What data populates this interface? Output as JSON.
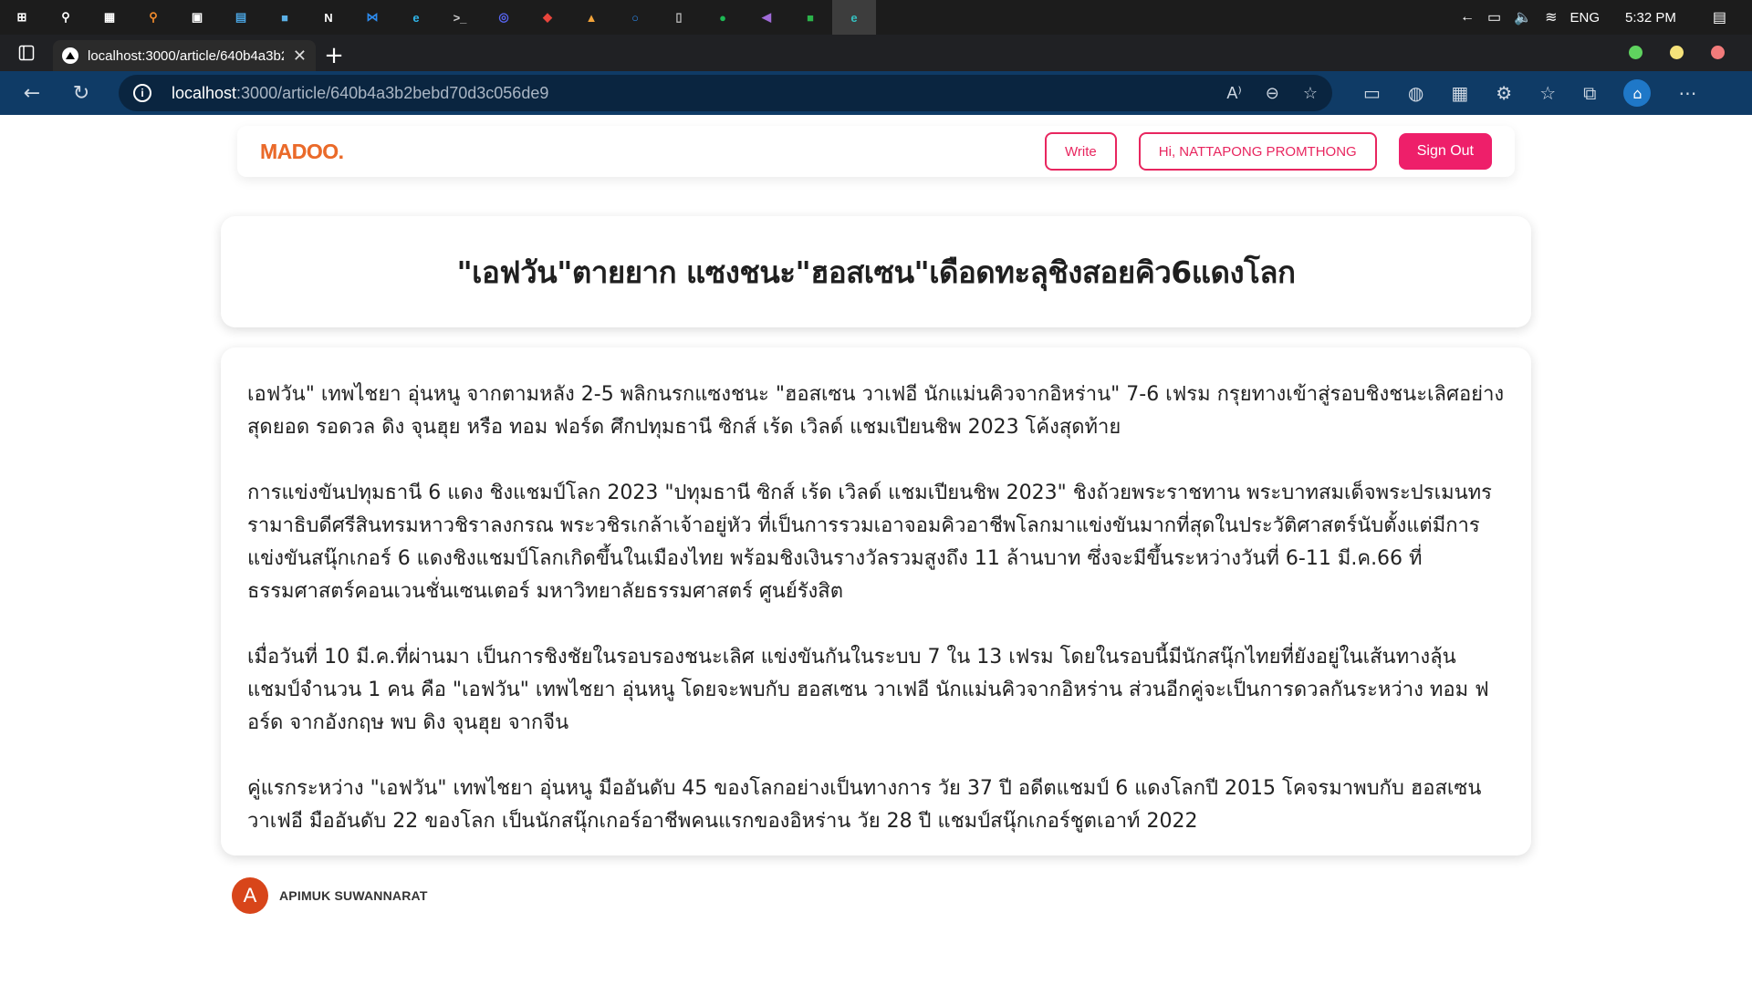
{
  "taskbar": {
    "apps": [
      {
        "name": "start-icon",
        "glyph": "⊞",
        "color": "#ffffff"
      },
      {
        "name": "search-icon",
        "glyph": "⚲",
        "color": "#ffffff"
      },
      {
        "name": "task-view-icon",
        "glyph": "▦",
        "color": "#ffffff"
      },
      {
        "name": "search-app-icon",
        "glyph": "⚲",
        "color": "#f08a2c"
      },
      {
        "name": "app-icon",
        "glyph": "▣",
        "color": "#ffffff"
      },
      {
        "name": "calculator-icon",
        "glyph": "▤",
        "color": "#4aa3df"
      },
      {
        "name": "folder-icon",
        "glyph": "■",
        "color": "#5bb0e6"
      },
      {
        "name": "notion-icon",
        "glyph": "N",
        "color": "#ffffff"
      },
      {
        "name": "vscode-icon",
        "glyph": "⋈",
        "color": "#2d8cf0"
      },
      {
        "name": "edge-icon",
        "glyph": "e",
        "color": "#2fb5e8"
      },
      {
        "name": "terminal-icon",
        "glyph": ">_",
        "color": "#cccccc"
      },
      {
        "name": "discord-icon",
        "glyph": "◎",
        "color": "#5865f2"
      },
      {
        "name": "app-red-icon",
        "glyph": "◆",
        "color": "#e8453c"
      },
      {
        "name": "app-orange-icon",
        "glyph": "▲",
        "color": "#f2a33a"
      },
      {
        "name": "circle-app-icon",
        "glyph": "○",
        "color": "#2d8cf0"
      },
      {
        "name": "app-dark-icon",
        "glyph": "▯",
        "color": "#bbbbbb"
      },
      {
        "name": "spotify-icon",
        "glyph": "●",
        "color": "#1db954"
      },
      {
        "name": "visual-studio-icon",
        "glyph": "◀",
        "color": "#a06bd8"
      },
      {
        "name": "line-icon",
        "glyph": "■",
        "color": "#2bb34a"
      },
      {
        "name": "edge-active-icon",
        "glyph": "e",
        "color": "#35c0c0"
      }
    ],
    "tray": {
      "lang": "ENG",
      "time": "5:32 PM"
    }
  },
  "browser": {
    "tab_title": "localhost:3000/article/640b4a3b2",
    "url_host": "localhost",
    "url_path": ":3000/article/640b4a3b2bebd70d3c056de9"
  },
  "site": {
    "logo": "MADOO.",
    "write_label": "Write",
    "greeting": "Hi, NATTAPONG PROMTHONG",
    "signout_label": "Sign Out"
  },
  "article": {
    "title": "\"เอฟวัน\"ตายยาก แซงชนะ\"ฮอสเซน\"เดือดทะลุชิงสอยคิว6แดงโลก",
    "paragraphs": [
      "เอฟวัน\" เทพไชยา อุ่นหนู จากตามหลัง 2-5 พลิกนรกแซงชนะ \"ฮอสเซน วาเฟอี นักแม่นคิวจากอิหร่าน\" 7-6 เฟรม กรุยทางเข้าสู่รอบชิงชนะเลิศอย่างสุดยอด รอดวล ดิง จุนฮุย หรือ ทอม ฟอร์ด ศึกปทุมธานี ซิกส์ เร้ด เวิลด์ แชมเปียนชิพ 2023 โค้งสุดท้าย",
      "การแข่งขันปทุมธานี 6 แดง ชิงแชมป์โลก 2023 \"ปทุมธานี ซิกส์ เร้ด เวิลด์ แชมเปียนชิพ 2023\" ชิงถ้วยพระราชทาน พระบาทสมเด็จพระปรเมนทรรามาธิบดีศรีสินทรมหาวชิราลงกรณ พระวชิรเกล้าเจ้าอยู่หัว ที่เป็นการรวมเอาจอมคิวอาชีพโลกมาแข่งขันมากที่สุดในประวัติศาสตร์นับตั้งแต่มีการแข่งขันสนุ๊กเกอร์ 6 แดงชิงแชมป์โลกเกิดขึ้นในเมืองไทย พร้อมชิงเงินรางวัลรวมสูงถึง 11 ล้านบาท ซึ่งจะมีขึ้นระหว่างวันที่ 6-11 มี.ค.66 ที่ธรรมศาสตร์คอนเวนชั่นเซนเตอร์ มหาวิทยาลัยธรรมศาสตร์ ศูนย์รังสิต",
      "เมื่อวันที่ 10 มี.ค.ที่ผ่านมา เป็นการชิงชัยในรอบรองชนะเลิศ แข่งขันกันในระบบ 7 ใน 13 เฟรม โดยในรอบนี้มีนักสนุ๊กไทยที่ยังอยู่ในเส้นทางลุ้นแชมป์จำนวน 1 คน คือ \"เอฟวัน\" เทพไชยา อุ่นหนู โดยจะพบกับ ฮอสเซน วาเฟอี นักแม่นคิวจากอิหร่าน ส่วนอีกคู่จะเป็นการดวลกันระหว่าง ทอม ฟอร์ด จากอังกฤษ พบ ดิง จุนฮุย จากจีน",
      "คู่แรกระหว่าง \"เอฟวัน\" เทพไชยา อุ่นหนู มืออันดับ 45 ของโลกอย่างเป็นทางการ วัย 37 ปี อดีตแชมป์ 6 แดงโลกปี 2015 โคจรมาพบกับ ฮอสเซน วาเฟอี มืออันดับ 22 ของโลก เป็นนักสนุ๊กเกอร์อาชีพคนแรกของอิหร่าน วัย 28 ปี แชมป์สนุ๊กเกอร์ชูตเอาท์ 2022"
    ],
    "author_initial": "A",
    "author_name": "APIMUK SUWANNARAT"
  },
  "colors": {
    "accent": "#ee1f6a",
    "logo": "#ea6a2a",
    "avatar": "#d8451a",
    "nav_bg": "#0f3b66"
  }
}
